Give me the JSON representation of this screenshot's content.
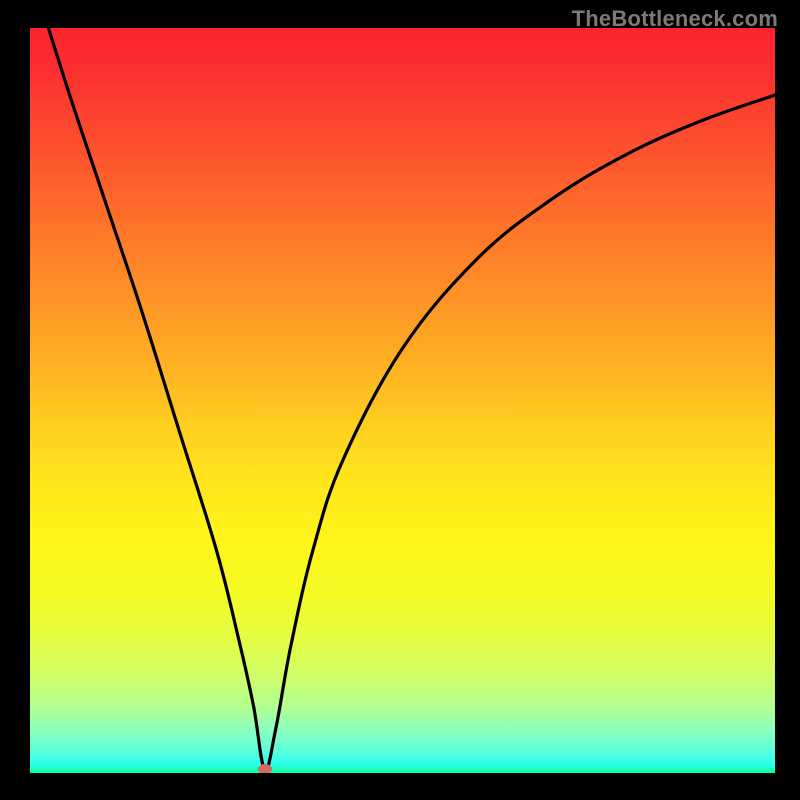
{
  "watermark": "TheBottleneck.com",
  "colors": {
    "background": "#000000",
    "curve": "#000000",
    "marker": "#d9685e"
  },
  "chart_data": {
    "type": "line",
    "title": "",
    "xlabel": "",
    "ylabel": "",
    "xlim": [
      0,
      100
    ],
    "ylim": [
      0,
      100
    ],
    "series": [
      {
        "name": "bottleneck-curve",
        "x": [
          0,
          5,
          10,
          15,
          20,
          25,
          28,
          30,
          31.5,
          33,
          35,
          38,
          42,
          50,
          60,
          70,
          80,
          90,
          100
        ],
        "values": [
          108,
          92,
          77,
          62,
          46,
          30,
          18,
          9,
          0.5,
          6,
          17,
          30,
          42,
          57,
          69,
          77,
          83,
          87.5,
          91
        ]
      }
    ],
    "annotations": [
      {
        "type": "marker",
        "x": 31.5,
        "y": 0.5,
        "name": "optimal-point"
      }
    ]
  }
}
